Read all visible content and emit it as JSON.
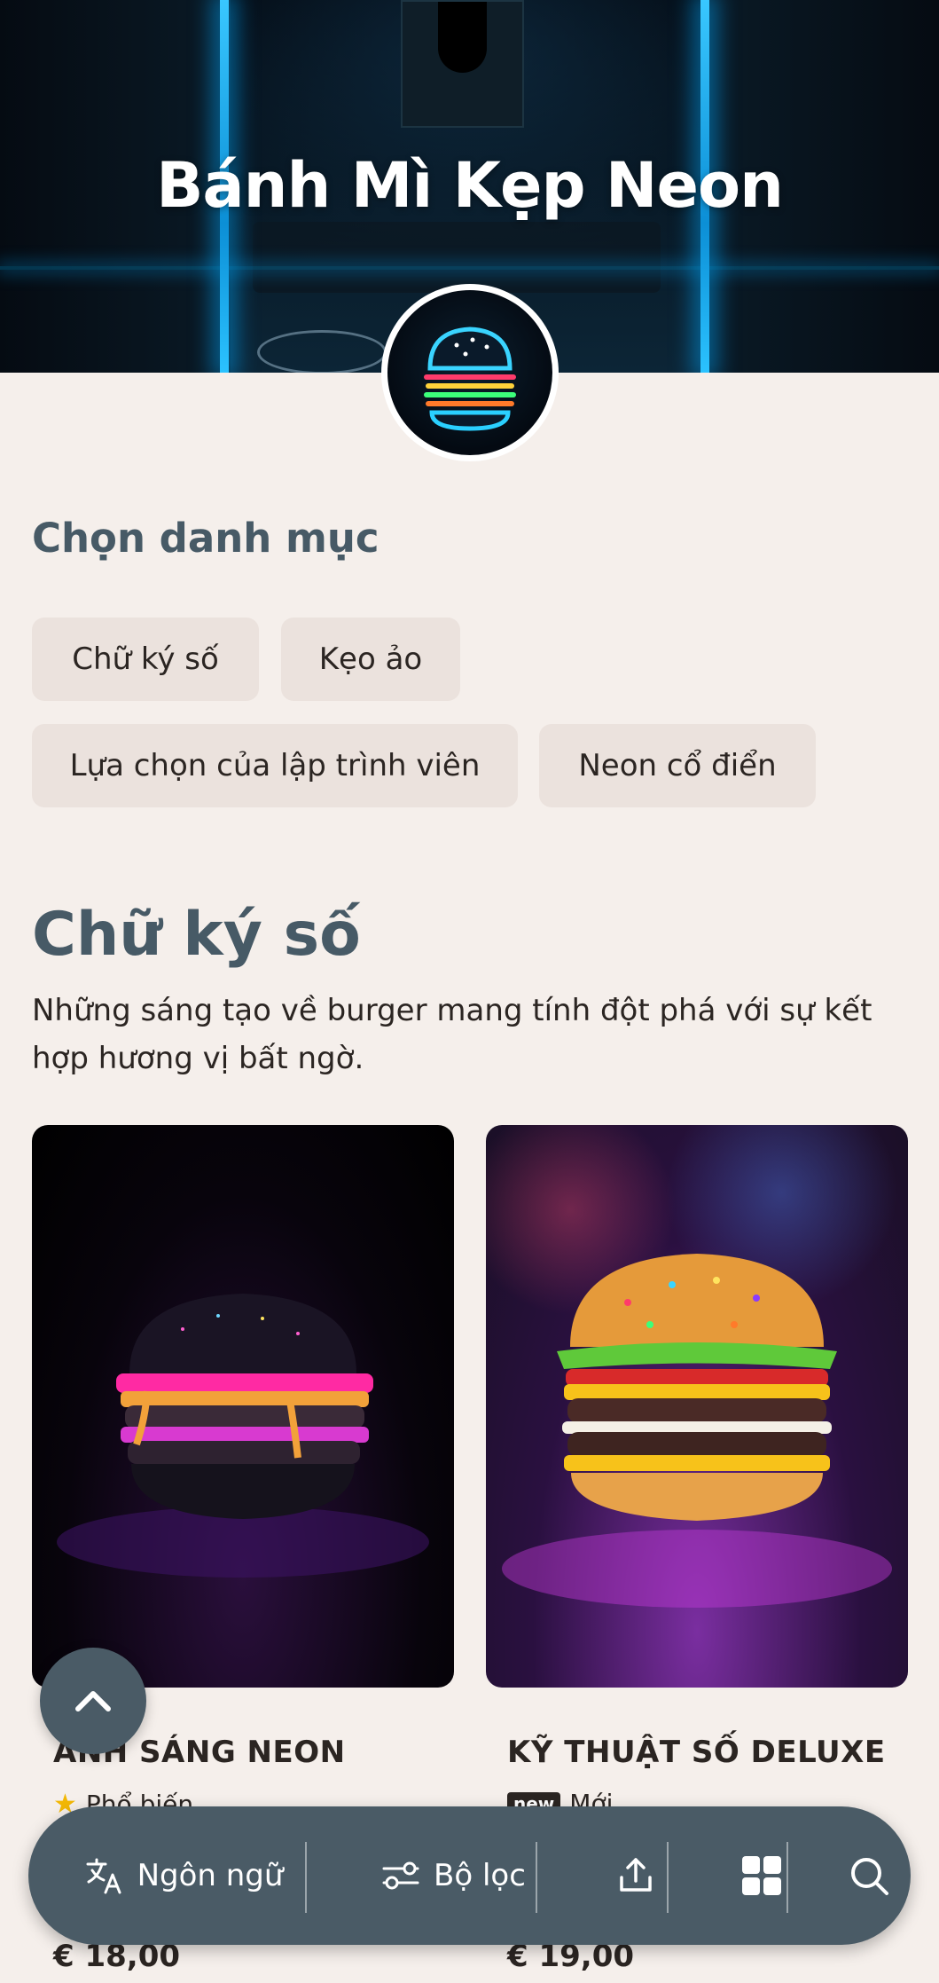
{
  "header": {
    "title": "Bánh Mì Kẹp Neon"
  },
  "categories": {
    "heading": "Chọn danh mục",
    "items": [
      {
        "label": "Chữ ký số"
      },
      {
        "label": "Kẹo ảo"
      },
      {
        "label": "Lựa chọn của lập trình viên"
      },
      {
        "label": "Neon cổ điển"
      }
    ]
  },
  "section": {
    "title": "Chữ ký số",
    "description": "Những sáng tạo về burger mang tính đột phá với sự kết hợp hương vị bất ngờ."
  },
  "products": [
    {
      "name": "ÁNH SÁNG NEON",
      "tag": "Phổ biến",
      "tag_icon": "star-icon",
      "price": "€ 18,00"
    },
    {
      "name": "KỸ THUẬT SỐ DELUXE",
      "badge": "new",
      "tag": "Mới",
      "price": "€ 19,00"
    }
  ],
  "bottom_bar": {
    "language_label": "Ngôn ngữ",
    "filter_label": "Bộ lọc",
    "icons": [
      "translate-icon",
      "filter-sliders-icon",
      "share-upload-icon",
      "grid-icon",
      "search-icon"
    ]
  },
  "colors": {
    "background": "#f5efeb",
    "accent": "#4a5b66",
    "heading": "#475a66",
    "chip": "#ebe2dd",
    "star": "#f2b705"
  }
}
